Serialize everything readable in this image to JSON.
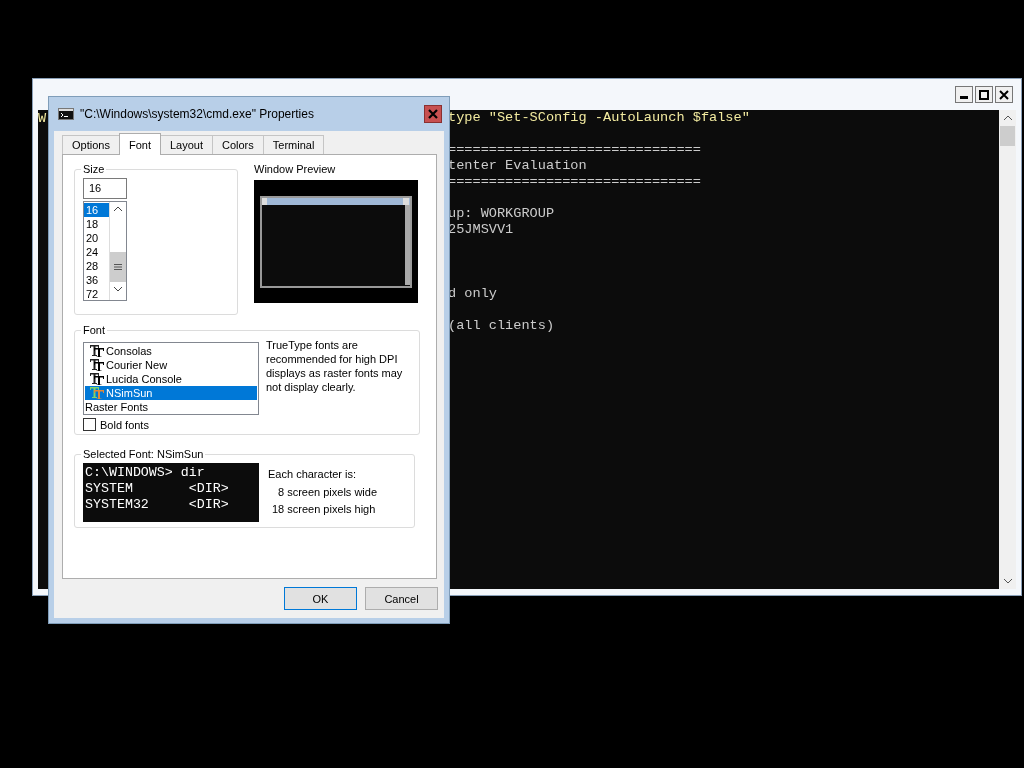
{
  "console_window": {
    "left_fragment": "W",
    "lines": [
      {
        "text": "type \"Set-SConfig -AutoLaunch $false\"",
        "kind": "highlight"
      },
      {
        "kind": "blank"
      },
      {
        "text": "===============================",
        "kind": "normal"
      },
      {
        "text": "tenter Evaluation",
        "kind": "normal"
      },
      {
        "text": "===============================",
        "kind": "normal"
      },
      {
        "kind": "blank"
      },
      {
        "text": "up: WORKGROUP",
        "kind": "normal"
      },
      {
        "text": "25JMSVV1",
        "kind": "normal"
      },
      {
        "kind": "blank"
      },
      {
        "kind": "blank"
      },
      {
        "kind": "blank"
      },
      {
        "text": "d only",
        "kind": "normal"
      },
      {
        "kind": "blank"
      },
      {
        "text": "(all clients)",
        "kind": "normal"
      }
    ]
  },
  "dialog": {
    "title": "\"C:\\Windows\\system32\\cmd.exe\" Properties",
    "tabs": [
      {
        "label": "Options",
        "selected": false
      },
      {
        "label": "Font",
        "selected": true
      },
      {
        "label": "Layout",
        "selected": false
      },
      {
        "label": "Colors",
        "selected": false
      },
      {
        "label": "Terminal",
        "selected": false
      }
    ],
    "size": {
      "label": "Size",
      "value": "16",
      "options": [
        {
          "label": "16",
          "selected": true
        },
        {
          "label": "18",
          "selected": false
        },
        {
          "label": "20",
          "selected": false
        },
        {
          "label": "24",
          "selected": false
        },
        {
          "label": "28",
          "selected": false
        },
        {
          "label": "36",
          "selected": false
        },
        {
          "label": "72",
          "selected": false
        }
      ]
    },
    "window_preview": {
      "label": "Window Preview"
    },
    "font": {
      "label": "Font",
      "options": [
        {
          "label": "Consolas",
          "kind": "truetype",
          "selected": false
        },
        {
          "label": "Courier New",
          "kind": "truetype",
          "selected": false
        },
        {
          "label": "Lucida Console",
          "kind": "truetype",
          "selected": false
        },
        {
          "label": "NSimSun",
          "kind": "truetype",
          "selected": true
        },
        {
          "label": "Raster Fonts",
          "kind": "raster",
          "selected": false
        }
      ],
      "note": "TrueType fonts are recommended for high DPI displays as raster fonts may not display clearly.",
      "bold": {
        "label": "Bold fonts",
        "checked": false
      }
    },
    "selected_font": {
      "label": "Selected Font: NSimSun",
      "sample": [
        "C:\\WINDOWS> dir",
        "SYSTEM       <DIR>",
        "SYSTEM32     <DIR>"
      ],
      "char_info": [
        "Each character is:",
        "8 screen pixels wide",
        "18 screen pixels high"
      ]
    },
    "buttons": [
      {
        "label": "OK",
        "default": true
      },
      {
        "label": "Cancel",
        "default": false
      }
    ]
  }
}
